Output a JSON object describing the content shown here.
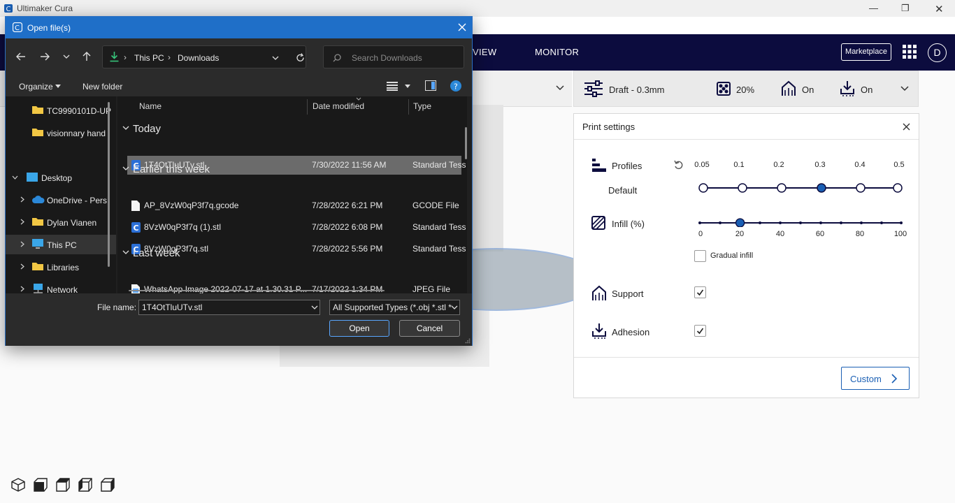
{
  "app": {
    "title": "Ultimaker Cura",
    "nav_tabs": [
      "VIEW",
      "MONITOR"
    ],
    "marketplace_label": "Marketplace",
    "avatar_letter": "D",
    "settings_summary": {
      "profile": "Draft - 0.3mm",
      "infill": "20%",
      "support": "On",
      "adhesion": "On"
    }
  },
  "print_settings": {
    "title": "Print settings",
    "profiles_label": "Profiles",
    "profile_default_label": "Default",
    "layer_heights": [
      "0.05",
      "0.1",
      "0.2",
      "0.3",
      "0.4",
      "0.5"
    ],
    "selected_layer_height": "0.3",
    "infill_label": "Infill (%)",
    "infill_ticks": [
      "0",
      "20",
      "40",
      "60",
      "80",
      "100"
    ],
    "infill_value": 20,
    "gradual_infill_label": "Gradual infill",
    "gradual_infill_checked": false,
    "support_label": "Support",
    "support_checked": true,
    "adhesion_label": "Adhesion",
    "adhesion_checked": true,
    "custom_button": "Custom"
  },
  "dialog": {
    "title": "Open file(s)",
    "breadcrumb": [
      "This PC",
      "Downloads"
    ],
    "search_placeholder": "Search Downloads",
    "organize_label": "Organize",
    "new_folder_label": "New folder",
    "nav_items": [
      {
        "label": "TC9990101D-UP",
        "icon": "folder-icon"
      },
      {
        "label": "visionnary hand",
        "icon": "folder-icon"
      },
      {
        "label": "Desktop",
        "icon": "desktop-icon"
      },
      {
        "label": "OneDrive - Pers",
        "icon": "cloud-icon"
      },
      {
        "label": "Dylan Vianen",
        "icon": "folder-icon"
      },
      {
        "label": "This PC",
        "icon": "pc-icon"
      },
      {
        "label": "Libraries",
        "icon": "folder-icon"
      },
      {
        "label": "Network",
        "icon": "network-icon"
      }
    ],
    "columns": {
      "name": "Name",
      "date": "Date modified",
      "type": "Type"
    },
    "groups": [
      {
        "label": "Today",
        "files": [
          {
            "name": "1T4OtTluUTv.stl",
            "date": "7/30/2022 11:56 AM",
            "type": "Standard Tess",
            "icon": "cura-file-icon",
            "selected": true
          }
        ]
      },
      {
        "label": "Earlier this week",
        "files": [
          {
            "name": "AP_8VzW0qP3f7q.gcode",
            "date": "7/28/2022 6:21 PM",
            "type": "GCODE File",
            "icon": "document-icon"
          },
          {
            "name": "8VzW0qP3f7q (1).stl",
            "date": "7/28/2022 6:08 PM",
            "type": "Standard Tess",
            "icon": "cura-file-icon"
          },
          {
            "name": "8VzW0qP3f7q.stl",
            "date": "7/28/2022 5:56 PM",
            "type": "Standard Tess",
            "icon": "cura-file-icon"
          }
        ]
      },
      {
        "label": "Last week",
        "files": [
          {
            "name": "WhatsApp Image 2022-07-17 at 1.30.31 P...",
            "date": "7/17/2022 1:34 PM",
            "type": "JPEG File",
            "icon": "image-file-icon"
          }
        ]
      }
    ],
    "file_name_label": "File name:",
    "file_name_value": "1T4OtTluUTv.stl",
    "file_type_value": "All Supported Types (*.obj *.stl *",
    "open_button": "Open",
    "cancel_button": "Cancel"
  }
}
